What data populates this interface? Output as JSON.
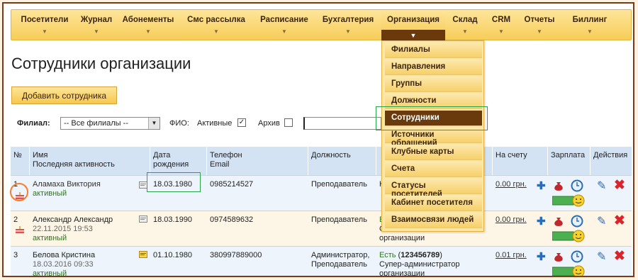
{
  "nav": {
    "items": [
      {
        "label": "Посетители"
      },
      {
        "label": "Журнал"
      },
      {
        "label": "Абонементы"
      },
      {
        "label": "Смс рассылка"
      },
      {
        "label": "Расписание"
      },
      {
        "label": "Бухгалтерия"
      },
      {
        "label": "Организация"
      },
      {
        "label": "Склад"
      },
      {
        "label": "CRM"
      },
      {
        "label": "Отчеты"
      },
      {
        "label": "Биллинг"
      }
    ],
    "active_index": 6
  },
  "page": {
    "title": "Сотрудники организации"
  },
  "toolbar": {
    "add_label": "Добавить сотрудника"
  },
  "filters": {
    "branch_label": "Филиал:",
    "branch_value": "-- Все филиалы --",
    "fio_label": "ФИО:",
    "active_label": "Активные",
    "active_checked": true,
    "archive_label": "Архив",
    "archive_checked": false,
    "fio_value": ""
  },
  "dropdown": {
    "items": [
      {
        "label": "Филиалы"
      },
      {
        "label": "Направления"
      },
      {
        "label": "Группы"
      },
      {
        "label": "Должности"
      },
      {
        "label": "Сотрудники"
      },
      {
        "label": "Источники обращений"
      },
      {
        "label": "Клубные карты"
      },
      {
        "label": "Счета"
      },
      {
        "label": "Статусы посетителей"
      },
      {
        "label": "Кабинет посетителя"
      },
      {
        "label": "Взаимосвязи людей"
      }
    ],
    "active_index": 4
  },
  "table": {
    "headers": {
      "num": "№",
      "name_1": "Имя",
      "name_2": "Последняя активность",
      "birth_1": "Дата",
      "birth_2": "рождения",
      "phone_1": "Телефон",
      "phone_2": "Email",
      "position": "Должность",
      "account": "На счету",
      "salary": "Зарплата",
      "actions": "Действия"
    },
    "rows": [
      {
        "num": "1",
        "name": "Аламаха Виктория",
        "last_active": "",
        "status": "активный",
        "birth": "18.03.1980",
        "phone": "0985214527",
        "position": "Преподаватель",
        "access_1": "Н",
        "access_2": "",
        "access_3": "",
        "balance": "0.00 грн."
      },
      {
        "num": "2",
        "name": "Александр Александр",
        "last_active": "22.11.2015 19:53",
        "status": "активный",
        "birth": "18.03.1990",
        "phone": "0974589632",
        "position": "Преподаватель",
        "access_1": "Е",
        "access_2": "С",
        "access_3": "организации",
        "balance": "0.00 грн."
      },
      {
        "num": "3",
        "name": "Белова Кристина",
        "last_active": "18.03.2016 09:33",
        "status": "активный",
        "birth": "01.10.1980",
        "phone": "380997889000",
        "position": "Администратор, Преподаватель",
        "access_1": "Есть",
        "access_code": "123456789",
        "access_2": "Супер-администратор",
        "access_3": "организации",
        "balance": "0.01 грн."
      }
    ]
  },
  "colors": {
    "nav_active": "#6b3a0c",
    "header_bg": "#d4e3f4",
    "green_status": "#2a7a18",
    "highlight": "#2ba34b",
    "circle": "#f08030"
  }
}
